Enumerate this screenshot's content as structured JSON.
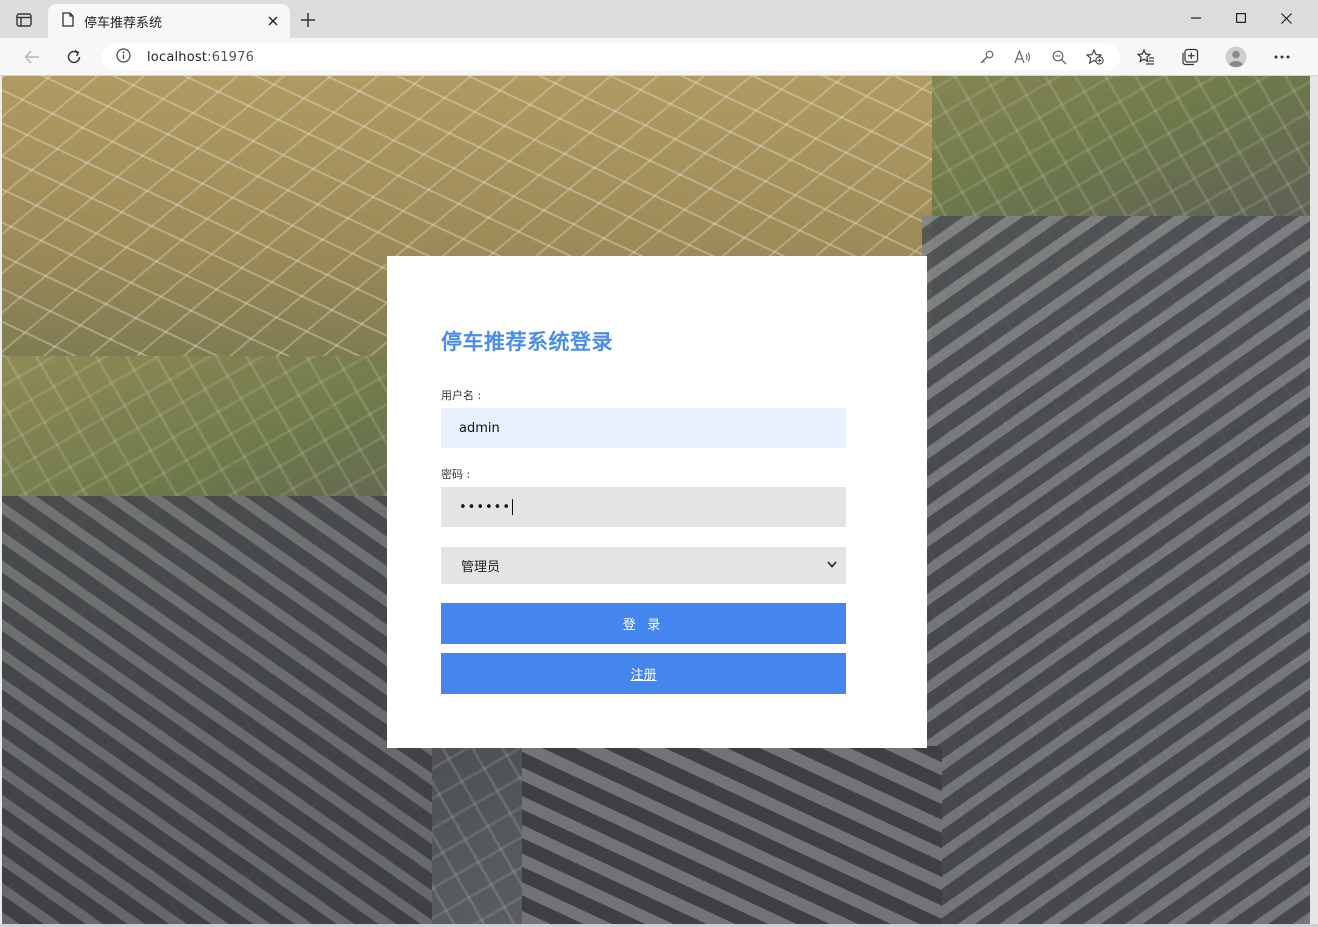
{
  "browser": {
    "tab_title": "停车推荐系统",
    "url_host": "localhost",
    "url_port": ":61976"
  },
  "icons": {
    "tab_actions": "tab-actions-icon",
    "page": "page-icon",
    "close": "close-icon",
    "new_tab": "plus-icon",
    "minimize": "minimize-icon",
    "maximize": "maximize-icon",
    "window_close": "window-close-icon",
    "back": "back-arrow-icon",
    "refresh": "refresh-icon",
    "info": "info-icon",
    "key": "key-icon",
    "read_aloud": "read-aloud-icon",
    "zoom_out": "zoom-out-icon",
    "favorite_add": "favorite-add-icon",
    "favorites": "favorites-icon",
    "collections": "collections-icon",
    "profile": "profile-icon",
    "more": "more-icon",
    "chevron_down": "chevron-down-icon"
  },
  "login": {
    "title": "停车推荐系统登录",
    "username_label": "用户名 :",
    "username_value": "admin",
    "password_label": "密码 :",
    "password_value": "••••••",
    "role_selected": "管理员",
    "login_button": "登 录",
    "register_button": "注册"
  },
  "colors": {
    "accent": "#4485ee",
    "title": "#4a8ee8",
    "input_autofill": "#e8f0fe",
    "input_bg": "#e4e4e4"
  }
}
